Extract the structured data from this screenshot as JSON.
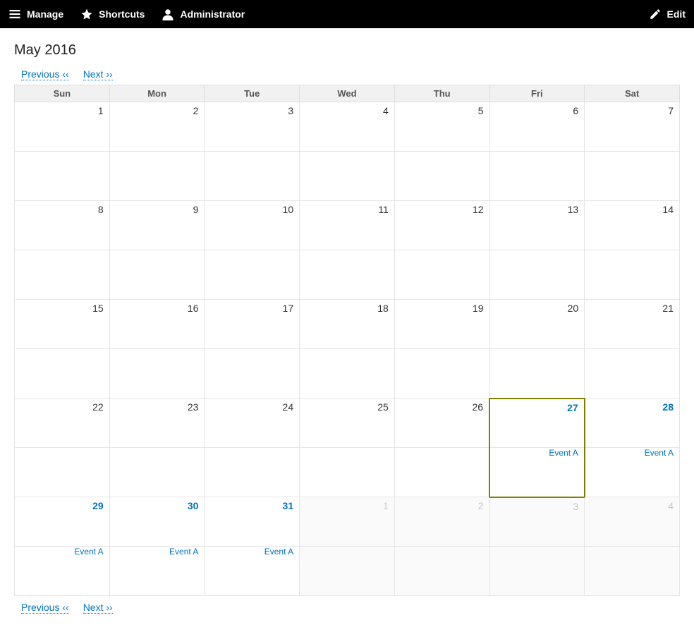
{
  "toolbar": {
    "manage": "Manage",
    "shortcuts": "Shortcuts",
    "user": "Administrator",
    "edit": "Edit"
  },
  "calendar": {
    "title": "May 2016",
    "prev": "Previous ‹‹",
    "next": "Next ››",
    "day_headers": [
      "Sun",
      "Mon",
      "Tue",
      "Wed",
      "Thu",
      "Fri",
      "Sat"
    ],
    "weeks": [
      [
        {
          "n": "1"
        },
        {
          "n": "2"
        },
        {
          "n": "3"
        },
        {
          "n": "4"
        },
        {
          "n": "5"
        },
        {
          "n": "6"
        },
        {
          "n": "7"
        }
      ],
      [
        {
          "n": "8"
        },
        {
          "n": "9"
        },
        {
          "n": "10"
        },
        {
          "n": "11"
        },
        {
          "n": "12"
        },
        {
          "n": "13"
        },
        {
          "n": "14"
        }
      ],
      [
        {
          "n": "15"
        },
        {
          "n": "16"
        },
        {
          "n": "17"
        },
        {
          "n": "18"
        },
        {
          "n": "19"
        },
        {
          "n": "20"
        },
        {
          "n": "21"
        }
      ],
      [
        {
          "n": "22"
        },
        {
          "n": "23"
        },
        {
          "n": "24"
        },
        {
          "n": "25"
        },
        {
          "n": "26"
        },
        {
          "n": "27",
          "link": true,
          "today": true,
          "event": "Event A"
        },
        {
          "n": "28",
          "link": true,
          "event": "Event A"
        }
      ],
      [
        {
          "n": "29",
          "link": true,
          "event": "Event A"
        },
        {
          "n": "30",
          "link": true,
          "event": "Event A"
        },
        {
          "n": "31",
          "link": true,
          "event": "Event A"
        },
        {
          "n": "1",
          "out": true
        },
        {
          "n": "2",
          "out": true
        },
        {
          "n": "3",
          "out": true
        },
        {
          "n": "4",
          "out": true
        }
      ]
    ]
  }
}
